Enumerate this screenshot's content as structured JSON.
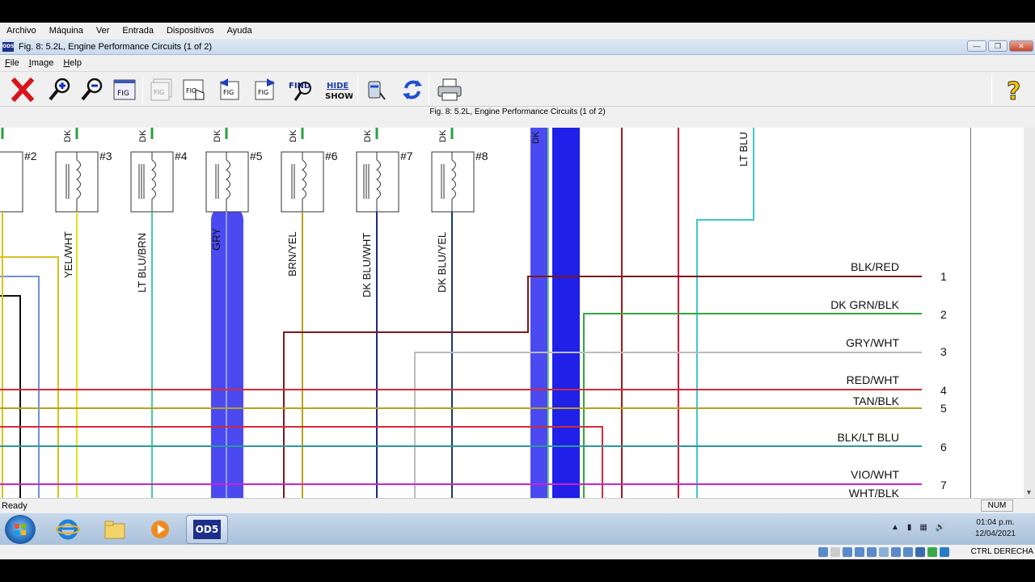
{
  "vbox_menu": [
    "Archivo",
    "Máquina",
    "Ver",
    "Entrada",
    "Dispositivos",
    "Ayuda"
  ],
  "window": {
    "title": "Fig. 8: 5.2L, Engine Performance Circuits (1 of 2)",
    "app_icon": "OD5"
  },
  "app_menu": [
    "File",
    "Image",
    "Help"
  ],
  "toolbar": {
    "find_label": "FIND",
    "hide_label": "HIDE",
    "show_label": "SHOW",
    "fig_label": "FIG"
  },
  "figure_caption": "Fig. 8: 5.2L, Engine Performance Circuits (1 of 2)",
  "diagram": {
    "injectors": [
      "#2",
      "#3",
      "#4",
      "#5",
      "#6",
      "#7",
      "#8"
    ],
    "top_stub_label": "DK",
    "injector_wires": [
      "YEL/WHT",
      "LT BLU/BRN",
      "GRY",
      "BRN/YEL",
      "DK BLU/WHT",
      "DK BLU/YEL"
    ],
    "lt_blu_label": "LT BLU",
    "dk_label": "DK",
    "connector_wires": [
      {
        "label": "BLK/RED",
        "pin": "1",
        "color": "#7a1a1a"
      },
      {
        "label": "DK GRN/BLK",
        "pin": "2",
        "color": "#2faa3a"
      },
      {
        "label": "GRY/WHT",
        "pin": "3",
        "color": "#bbbbbb"
      },
      {
        "label": "RED/WHT",
        "pin": "4",
        "color": "#d42a3a"
      },
      {
        "label": "TAN/BLK",
        "pin": "5",
        "color": "#b8a020"
      },
      {
        "label": "BLK/LT BLU",
        "pin": "6",
        "color": "#2a9a9a"
      },
      {
        "label": "VIO/WHT",
        "pin": "7",
        "color": "#cc22cc"
      },
      {
        "label": "WHT/BLK",
        "pin": "",
        "color": "#555555"
      }
    ],
    "highlight_color": "#4a4af0"
  },
  "status": {
    "ready": "Ready",
    "num": "NUM"
  },
  "taskbar": {
    "active_app": "OD5",
    "time": "01:04 p.m.",
    "date": "12/04/2021"
  },
  "vbox_status": {
    "host_key": "CTRL DERECHA"
  }
}
